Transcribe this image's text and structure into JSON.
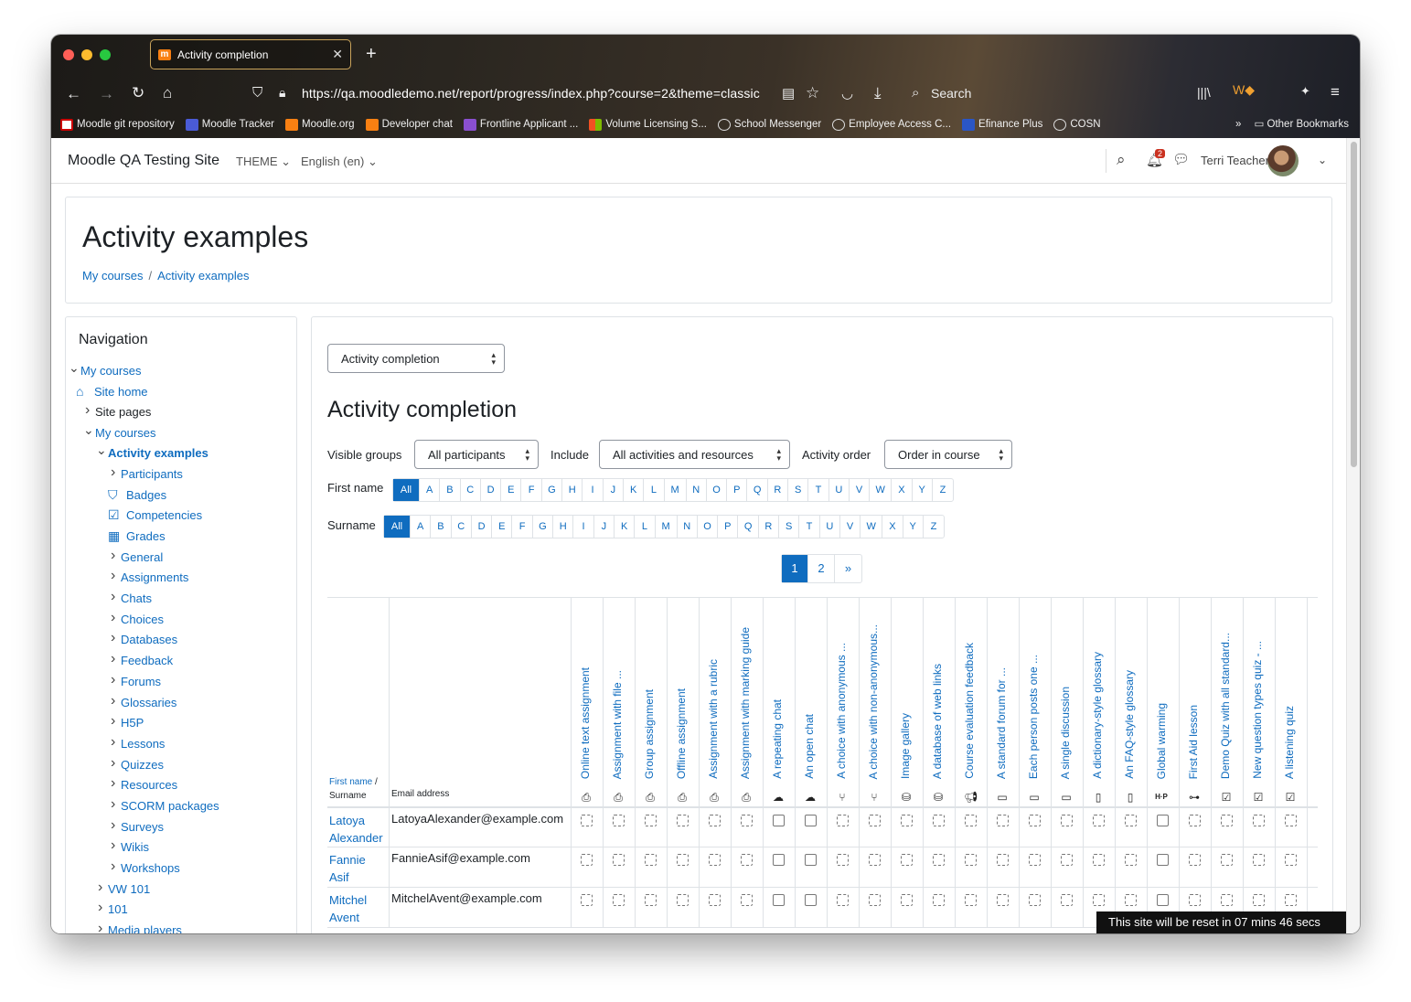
{
  "browser": {
    "tab_title": "Activity completion",
    "tab_icon": "moodle-icon",
    "url": "https://qa.moodledemo.net/report/progress/index.php?course=2&theme=classic",
    "search_label": "Search",
    "bookmarks": [
      "Moodle git repository",
      "Moodle Tracker",
      "Moodle.org",
      "Developer chat",
      "Frontline Applicant ...",
      "Volume Licensing S...",
      "School Messenger",
      "Employee Access C...",
      "Efinance Plus",
      "COSN"
    ],
    "other_bookmarks": "Other Bookmarks"
  },
  "topbar": {
    "site_name": "Moodle QA Testing Site",
    "theme_menu": "THEME",
    "language_menu": "English (en)",
    "notification_count": "2",
    "user_name": "Terri Teacher"
  },
  "header": {
    "title": "Activity examples",
    "breadcrumbs": [
      "My courses",
      "Activity examples"
    ]
  },
  "navigation": {
    "title": "Navigation",
    "items": [
      "My courses",
      "Site home",
      "Site pages",
      "My courses",
      "Activity examples",
      "Participants",
      "Badges",
      "Competencies",
      "Grades",
      "General",
      "Assignments",
      "Chats",
      "Choices",
      "Databases",
      "Feedback",
      "Forums",
      "Glossaries",
      "H5P",
      "Lessons",
      "Quizzes",
      "Resources",
      "SCORM packages",
      "Surveys",
      "Wikis",
      "Workshops",
      "VW 101",
      "101",
      "Media players"
    ]
  },
  "report": {
    "report_select": "Activity completion",
    "heading": "Activity completion",
    "visible_groups_label": "Visible groups",
    "visible_groups_value": "All participants",
    "include_label": "Include",
    "include_value": "All activities and resources",
    "activity_order_label": "Activity order",
    "activity_order_value": "Order in course",
    "first_name_label": "First name",
    "surname_label": "Surname",
    "letters": [
      "All",
      "A",
      "B",
      "C",
      "D",
      "E",
      "F",
      "G",
      "H",
      "I",
      "J",
      "K",
      "L",
      "M",
      "N",
      "O",
      "P",
      "Q",
      "R",
      "S",
      "T",
      "U",
      "V",
      "W",
      "X",
      "Y",
      "Z"
    ],
    "pages": [
      "1",
      "2",
      "»"
    ],
    "col_firstname": "First name",
    "col_slash": " /",
    "col_surname": "Surname",
    "col_email": "Email address",
    "activities": [
      {
        "name": "Online text assignment",
        "icon": "assignment-icon"
      },
      {
        "name": "Assignment with file ...",
        "icon": "assignment-icon"
      },
      {
        "name": "Group assignment",
        "icon": "assignment-icon"
      },
      {
        "name": "Offline assignment",
        "icon": "assignment-icon"
      },
      {
        "name": "Assignment with a rubric",
        "icon": "assignment-icon"
      },
      {
        "name": "Assignment with marking guide",
        "icon": "assignment-icon"
      },
      {
        "name": "A repeating chat",
        "icon": "chat-icon"
      },
      {
        "name": "An open chat",
        "icon": "chat-icon"
      },
      {
        "name": "A choice with anonymous ...",
        "icon": "choice-icon"
      },
      {
        "name": "A choice with non-anonymous...",
        "icon": "choice-icon"
      },
      {
        "name": "Image gallery",
        "icon": "database-icon"
      },
      {
        "name": "A database of web links",
        "icon": "database-icon"
      },
      {
        "name": "Course evaluation feedback",
        "icon": "feedback-icon"
      },
      {
        "name": "A standard forum for ...",
        "icon": "forum-icon"
      },
      {
        "name": "Each person posts one ...",
        "icon": "forum-icon"
      },
      {
        "name": "A single discussion",
        "icon": "forum-icon"
      },
      {
        "name": "A dictionary-style glossary",
        "icon": "glossary-icon"
      },
      {
        "name": "An FAQ-style glossary",
        "icon": "glossary-icon"
      },
      {
        "name": "Global warming",
        "icon": "h5p-icon"
      },
      {
        "name": "First Aid lesson",
        "icon": "lesson-icon"
      },
      {
        "name": "Demo Quiz with all standard...",
        "icon": "quiz-icon"
      },
      {
        "name": "New question types quiz - ...",
        "icon": "quiz-icon"
      },
      {
        "name": "A listening quiz",
        "icon": "quiz-icon"
      }
    ],
    "rows": [
      {
        "first": "Latoya",
        "last": "Alexander",
        "email": "LatoyaAlexander@example.com"
      },
      {
        "first": "Fannie",
        "last": "Asif",
        "email": "FannieAsif@example.com"
      },
      {
        "first": "Mitchel",
        "last": "Avent",
        "email": "MitchelAvent@example.com"
      }
    ]
  },
  "toast": "This site will be reset in 07 mins 46 secs"
}
